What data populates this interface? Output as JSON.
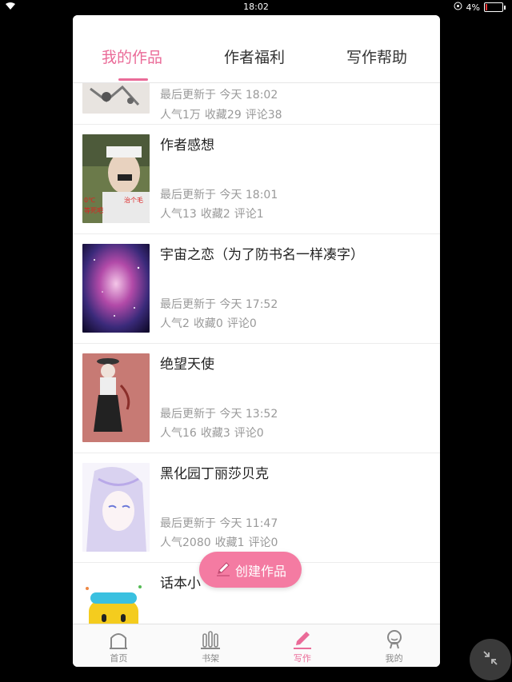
{
  "status_bar": {
    "time": "18:02",
    "battery_percent": "4%"
  },
  "tabs": [
    {
      "label": "我的作品",
      "active": true
    },
    {
      "label": "作者福利",
      "active": false
    },
    {
      "label": "写作帮助",
      "active": false
    }
  ],
  "works": [
    {
      "title": "",
      "updated": "最后更新于 今天 18:02",
      "popularity": "人气1万",
      "favorites": "收藏29",
      "comments": "评论38"
    },
    {
      "title": "作者感想",
      "updated": "最后更新于 今天 18:01",
      "popularity": "人气13",
      "favorites": "收藏2",
      "comments": "评论1"
    },
    {
      "title": "宇宙之恋（为了防书名一样凑字）",
      "updated": "最后更新于 今天 17:52",
      "popularity": "人气2",
      "favorites": "收藏0",
      "comments": "评论0"
    },
    {
      "title": "绝望天使",
      "updated": "最后更新于 今天 13:52",
      "popularity": "人气16",
      "favorites": "收藏3",
      "comments": "评论0"
    },
    {
      "title": "黑化园丁丽莎贝克",
      "updated": "最后更新于 今天 11:47",
      "popularity": "人气2080",
      "favorites": "收藏1",
      "comments": "评论0"
    },
    {
      "title": "话本小",
      "updated": "",
      "popularity": "",
      "favorites": "",
      "comments": ""
    }
  ],
  "create_button": {
    "label": "创建作品"
  },
  "bottom_nav": [
    {
      "label": "首页",
      "icon": "home-icon",
      "active": false
    },
    {
      "label": "书架",
      "icon": "bookshelf-icon",
      "active": false
    },
    {
      "label": "写作",
      "icon": "pen-icon",
      "active": true
    },
    {
      "label": "我的",
      "icon": "profile-icon",
      "active": false
    }
  ],
  "colors": {
    "accent": "#ea6b98",
    "button": "#f47ba2",
    "muted": "#999999"
  }
}
